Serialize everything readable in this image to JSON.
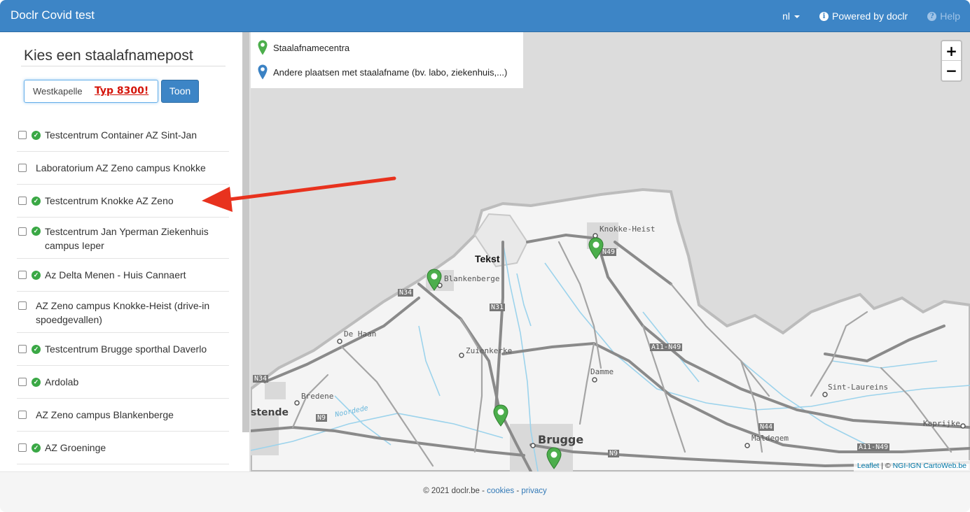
{
  "navbar": {
    "brand": "Doclr Covid test",
    "language": "nl",
    "powered_by": "Powered by doclr",
    "help": "Help"
  },
  "sidebar": {
    "title": "Kies een staalafnamepost",
    "search_value": "Westkapelle",
    "annotation": "Typ 8300!",
    "show_button": "Toon",
    "items": [
      {
        "label": "Testcentrum Container AZ Sint-Jan",
        "label2": "",
        "verified": true
      },
      {
        "label": "Laboratorium AZ Zeno campus Knokke",
        "label2": "",
        "verified": false
      },
      {
        "label": "Testcentrum Knokke AZ Zeno",
        "label2": "",
        "verified": true
      },
      {
        "label": "Testcentrum Jan Yperman Ziekenhuis",
        "label2": "campus Ieper",
        "verified": true
      },
      {
        "label": "Az Delta Menen - Huis Cannaert",
        "label2": "",
        "verified": true
      },
      {
        "label": "AZ Zeno campus Knokke-Heist (drive-in",
        "label2": "spoedgevallen)",
        "verified": false
      },
      {
        "label": "Testcentrum Brugge sporthal Daverlo",
        "label2": "",
        "verified": true
      },
      {
        "label": "Ardolab",
        "label2": "",
        "verified": true
      },
      {
        "label": "AZ Zeno campus Blankenberge",
        "label2": "",
        "verified": false
      },
      {
        "label": "AZ Groeninge",
        "label2": "",
        "verified": true
      }
    ]
  },
  "map": {
    "legend": {
      "centers": "Staalafnamecentra",
      "others": "Andere plaatsen met staalafname (bv. labo, ziekenhuis,...)"
    },
    "zoom_in": "+",
    "zoom_out": "−",
    "attribution_leaflet": "Leaflet",
    "attribution_sep": " | © ",
    "attribution_source": "NGI-IGN CartoWeb.be",
    "labels": {
      "tekst": "Tekst",
      "knokke": "Knokke-Heist",
      "blankenberge": "Blankenberge",
      "dehaan": "De Haan",
      "zuienkerke": "Zuienkerke",
      "damme": "Damme",
      "bredene": "Bredene",
      "stende": "stende",
      "brugge": "Brugge",
      "maldegem": "Maldegem",
      "sintlaureins": "Sint-Laureins",
      "kaprijke": "Kaprijke",
      "n49": "N49",
      "n34": "N34",
      "n31": "N31",
      "n34b": "N34",
      "n9": "N9",
      "n9b": "N9",
      "a11n49": "A11-N49",
      "a11n49b": "A11-N49",
      "n44": "N44",
      "noordede": "Noordede"
    },
    "colors": {
      "green_pin": "#4cae4c",
      "blue_pin": "#3b82c4"
    }
  },
  "footer": {
    "copyright": "© 2021 doclr.be - ",
    "cookies": "cookies",
    "sep": " - ",
    "privacy": "privacy"
  }
}
